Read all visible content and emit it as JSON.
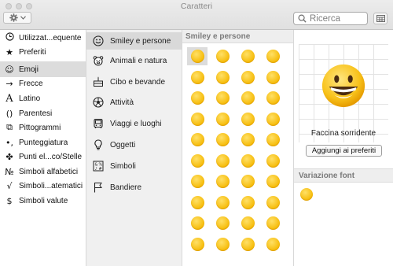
{
  "window": {
    "title": "Caratteri"
  },
  "toolbar": {
    "gear_icon": "gear-icon",
    "search_placeholder": "Ricerca",
    "grid_icon": "grid-view-icon"
  },
  "sidebar": {
    "items": [
      {
        "label": "Utilizzat...equente",
        "icon": "clock-icon",
        "glyph": "🕘"
      },
      {
        "label": "Preferiti",
        "icon": "star-icon",
        "glyph": "★"
      },
      {
        "label": "Emoji",
        "icon": "smiley-icon",
        "glyph": "☺"
      },
      {
        "label": "Frecce",
        "icon": "arrow-icon",
        "glyph": "→"
      },
      {
        "label": "Latino",
        "icon": "latin-letter-icon",
        "glyph": "A"
      },
      {
        "label": "Parentesi",
        "icon": "parentheses-icon",
        "glyph": "()"
      },
      {
        "label": "Pittogrammi",
        "icon": "pictogram-icon",
        "glyph": "⧉"
      },
      {
        "label": "Punteggiatura",
        "icon": "punctuation-icon",
        "glyph": "•,"
      },
      {
        "label": "Punti el...co/Stelle",
        "icon": "bullet-star-icon",
        "glyph": "✤"
      },
      {
        "label": "Simboli alfabetici",
        "icon": "letterlike-icon",
        "glyph": "№"
      },
      {
        "label": "Simboli...atematici",
        "icon": "math-icon",
        "glyph": "√"
      },
      {
        "label": "Simboli valute",
        "icon": "currency-icon",
        "glyph": "$"
      }
    ],
    "selected": "Emoji"
  },
  "categories": {
    "items": [
      {
        "label": "Smiley e persone",
        "icon": "smiley-outline-icon"
      },
      {
        "label": "Animali e natura",
        "icon": "bear-icon"
      },
      {
        "label": "Cibo e bevande",
        "icon": "cake-icon"
      },
      {
        "label": "Attività",
        "icon": "soccer-ball-icon"
      },
      {
        "label": "Viaggi e luoghi",
        "icon": "bus-icon"
      },
      {
        "label": "Oggetti",
        "icon": "lightbulb-icon"
      },
      {
        "label": "Simboli",
        "icon": "symbols-icon"
      },
      {
        "label": "Bandiere",
        "icon": "flag-icon"
      }
    ],
    "selected": "Smiley e persone"
  },
  "grid": {
    "header": "Smiley e persone",
    "emojis": [
      "😀",
      "😬",
      "😁",
      "😂",
      "😃",
      "😄",
      "😅",
      "😆",
      "😇",
      "😉",
      "😊",
      "🙂",
      "🙃",
      "☺️",
      "😋",
      "😌",
      "😍",
      "😘",
      "😗",
      "😙",
      "😚",
      "😜",
      "😝",
      "😛",
      "🤑",
      "🤓",
      "😎",
      "🤗",
      "😏",
      "😶",
      "😐",
      "😑",
      "😒",
      "🙄",
      "🤔",
      "😳",
      "😞",
      "😟",
      "😠",
      "😡"
    ],
    "selected_index": 0
  },
  "detail": {
    "character_name": "Faccina sorridente",
    "favorite_button": "Aggiungi ai preferiti",
    "variant_header": "Variazione font"
  },
  "colors": {
    "emoji_yellow": "#f5b800",
    "selection_gray": "#dcdcdc",
    "header_text": "#7b7b7b"
  }
}
